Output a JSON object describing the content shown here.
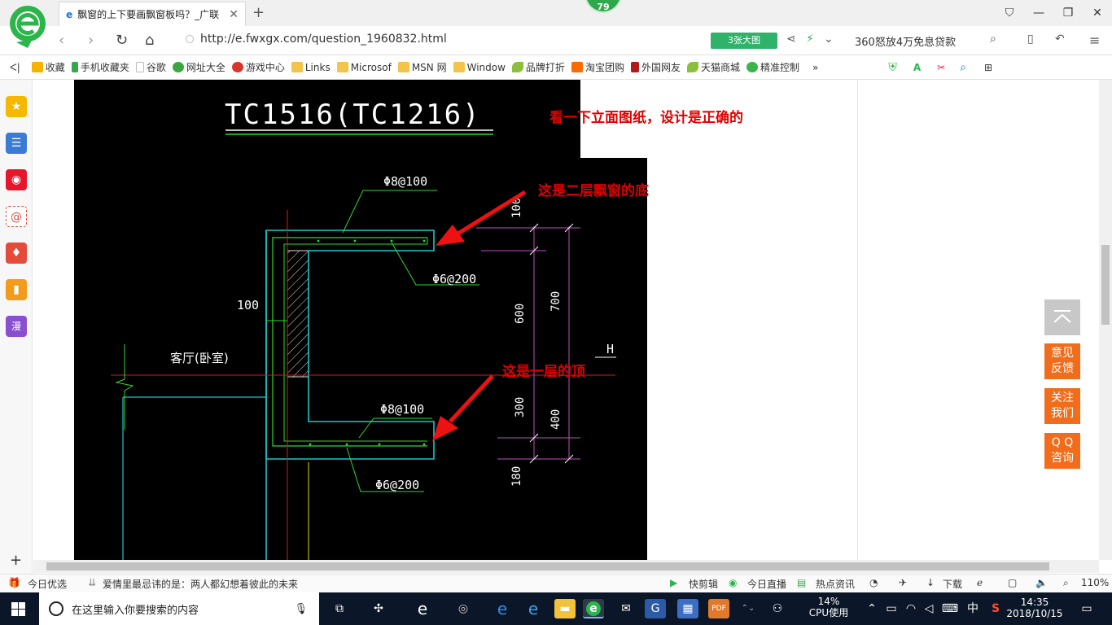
{
  "browser": {
    "tab_title": "飘窗的上下要画飘窗板吗？_广联",
    "badge_count": "79",
    "url": "http://e.fwxgx.com/question_1960832.html",
    "big_image_label": "3张大图",
    "ad_text": "360怒放4万免息贷款"
  },
  "bookmarks": [
    {
      "label": "收藏",
      "color": "#f6b400"
    },
    {
      "label": "手机收藏夹",
      "color": "#37a54a"
    },
    {
      "label": "谷歌",
      "color": "#cccccc"
    },
    {
      "label": "网址大全",
      "color": "#3aa640"
    },
    {
      "label": "游戏中心",
      "color": "#d9342b"
    },
    {
      "label": "Links",
      "color": "#f3c34a"
    },
    {
      "label": "Microsof",
      "color": "#f3c34a"
    },
    {
      "label": "MSN 网",
      "color": "#f3c34a"
    },
    {
      "label": "Window",
      "color": "#f3c34a"
    },
    {
      "label": "品牌打折",
      "color": "#8cbf3c"
    },
    {
      "label": "淘宝团购",
      "color": "#ff6a00"
    },
    {
      "label": "外国网友",
      "color": "#b21a1a"
    },
    {
      "label": "天猫商城",
      "color": "#8cbf3c"
    },
    {
      "label": "精准控制",
      "color": "#39b54a"
    }
  ],
  "sidebar_icons": [
    {
      "name": "favorites-icon",
      "color": "#f5b800",
      "glyph": "★"
    },
    {
      "name": "news-icon",
      "color": "#3a7bd5",
      "glyph": "☰"
    },
    {
      "name": "weibo-icon",
      "color": "#e6162d",
      "glyph": "◉"
    },
    {
      "name": "mail-icon",
      "color": "#e34b3b",
      "glyph": "@"
    },
    {
      "name": "game-icon",
      "color": "#e34b3b",
      "glyph": "♦"
    },
    {
      "name": "novel-icon",
      "color": "#f39b1a",
      "glyph": "▮"
    },
    {
      "name": "comic-icon",
      "color": "#8a4fd0",
      "glyph": "漫"
    }
  ],
  "drawing": {
    "title": "TC1516(TC1216)",
    "labels": {
      "rebar_top_1": "Φ8@100",
      "rebar_top_2": "Φ6@200",
      "rebar_bottom_1": "Φ8@100",
      "rebar_bottom_2": "Φ6@200",
      "wall": "100",
      "room": "客厅(卧室)",
      "level": "H",
      "dim_100": "100",
      "dim_600": "600",
      "dim_700": "700",
      "dim_300": "300",
      "dim_400": "400",
      "dim_180": "180"
    }
  },
  "annotations": {
    "note_top": "看一下立面图纸，设计是正确的",
    "note_mid": "这是二层飘窗的底",
    "note_low": "这是一层的顶"
  },
  "float_buttons": {
    "feedback": "意见反馈",
    "follow": "关注我们",
    "qq": "Q Q咨询"
  },
  "statusbar": {
    "today_pick": "今日优选",
    "headline": "爱情里最忌讳的是：两人都幻想着彼此的未来",
    "quick_edit": "快剪辑",
    "live": "今日直播",
    "hot_news": "热点资讯",
    "download": "下载",
    "zoom": "110%"
  },
  "taskbar": {
    "search_placeholder": "在这里输入你要搜索的内容",
    "cpu_percent": "14%",
    "cpu_label": "CPU使用",
    "ime": "中",
    "time": "14:35",
    "date": "2018/10/15"
  }
}
